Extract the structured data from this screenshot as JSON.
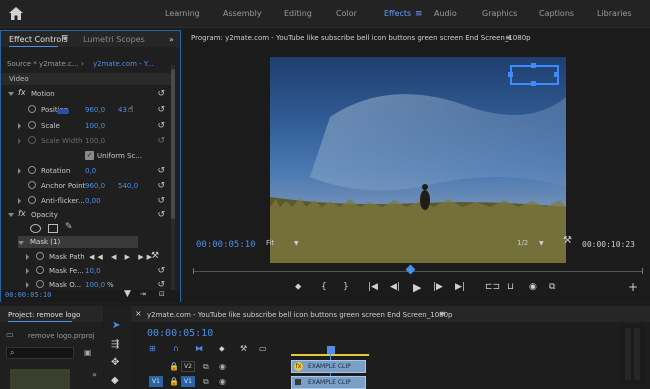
{
  "workspace": {
    "tabs": [
      "Learning",
      "Assembly",
      "Editing",
      "Color",
      "Effects",
      "Audio",
      "Graphics",
      "Captions",
      "Libraries"
    ],
    "active": "Effects"
  },
  "effect_controls": {
    "tab_label": "Effect Controls",
    "tab2_label": "Lumetri Scopes",
    "source_label": "Source * y2mate.c...",
    "clip_label": "y2mate.com - Y...",
    "section_video": "Video",
    "motion": "Motion",
    "position_label": "Position",
    "position_x": "960,0",
    "position_y": "43",
    "scale_label": "Scale",
    "scale_value": "100,0",
    "scale_width_label": "Scale Width",
    "scale_width_value": "100,0",
    "uniform_scale": "Uniform Sc...",
    "rotation_label": "Rotation",
    "rotation_value": "0,0",
    "anchor_label": "Anchor Point",
    "anchor_x": "960,0",
    "anchor_y": "540,0",
    "antiflicker_label": "Anti-flicker...",
    "antiflicker_value": "0,00",
    "opacity": "Opacity",
    "mask": "Mask (1)",
    "mask_path": "Mask Path",
    "mask_feather_label": "Mask Fe...",
    "mask_feather_value": "10,0",
    "mask_opacity_label": "Mask O...",
    "mask_opacity_value": "100,0",
    "mask_opacity_unit": "%",
    "timecode": "00:00:05:10"
  },
  "program": {
    "title": "Program: y2mate.com - YouTube like subscribe bell icon buttons green screen End Screen_1080p",
    "timecode_current": "00:00:05:10",
    "timecode_total": "00:00:10:23",
    "fit_label": "Fit",
    "resolution": "1/2"
  },
  "project": {
    "title": "Project: remove logo",
    "file": "remove logo.prproj"
  },
  "timeline": {
    "title": "y2mate.com - YouTube like subscribe bell icon buttons green screen End Screen_1080p",
    "timecode": "00:00:05:10",
    "tracks": [
      "V2",
      "V1"
    ],
    "source_patch": "V1",
    "clip_label": "EXAMPLE CLIP"
  },
  "colors": {
    "accent": "#4d8fe8",
    "panel_border": "#2a64a8",
    "clip": "#7aa0c8"
  }
}
